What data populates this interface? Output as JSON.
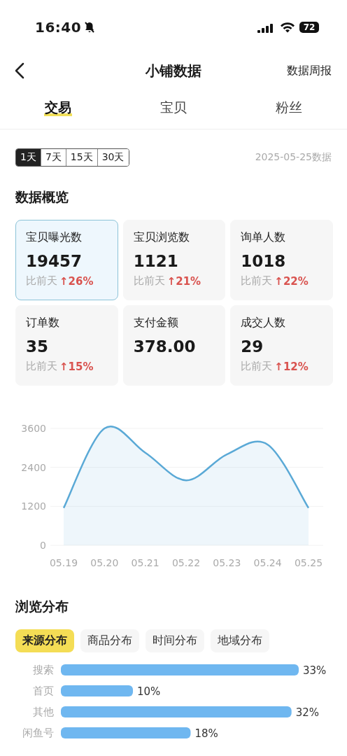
{
  "status_bar": {
    "time": "16:40",
    "battery": "72"
  },
  "nav": {
    "title": "小铺数据",
    "action": "数据周报"
  },
  "tabs": [
    {
      "label": "交易",
      "selected": true
    },
    {
      "label": "宝贝",
      "selected": false
    },
    {
      "label": "粉丝",
      "selected": false
    }
  ],
  "periods": [
    {
      "label": "1天",
      "selected": true
    },
    {
      "label": "7天",
      "selected": false
    },
    {
      "label": "15天",
      "selected": false
    },
    {
      "label": "30天",
      "selected": false
    }
  ],
  "date_note": "2025-05-25数据",
  "overview": {
    "title": "数据概览",
    "stats": [
      {
        "label": "宝贝曝光数",
        "value": "19457",
        "compare": "比前天",
        "change": "↑26%",
        "selected": true
      },
      {
        "label": "宝贝浏览数",
        "value": "1121",
        "compare": "比前天",
        "change": "↑21%",
        "selected": false
      },
      {
        "label": "询单人数",
        "value": "1018",
        "compare": "比前天",
        "change": "↑22%",
        "selected": false
      },
      {
        "label": "订单数",
        "value": "35",
        "compare": "比前天",
        "change": "↑15%",
        "selected": false
      },
      {
        "label": "支付金额",
        "value": "378.00",
        "selected": false
      },
      {
        "label": "成交人数",
        "value": "29",
        "compare": "比前天",
        "change": "↑12%",
        "selected": false
      }
    ]
  },
  "trend_chart": {
    "chart_data": {
      "type": "area",
      "categories": [
        "05.19",
        "05.20",
        "05.21",
        "05.22",
        "05.23",
        "05.24",
        "05.25"
      ],
      "series": [
        {
          "color": "#5aa9d6",
          "values": [
            1150,
            3600,
            2850,
            2000,
            2800,
            3100,
            1150
          ]
        }
      ],
      "ylim": [
        0,
        3600
      ],
      "yticks": [
        0,
        1200,
        2400,
        3600
      ]
    }
  },
  "distribution": {
    "title": "浏览分布",
    "chips": [
      {
        "label": "来源分布",
        "selected": true
      },
      {
        "label": "商品分布",
        "selected": false
      },
      {
        "label": "时间分布",
        "selected": false
      },
      {
        "label": "地域分布",
        "selected": false
      }
    ],
    "chart_data": {
      "type": "bar",
      "orientation": "horizontal",
      "categories": [
        "搜索",
        "首页",
        "其他",
        "闲鱼号"
      ],
      "values": [
        33,
        10,
        32,
        18
      ],
      "value_labels": [
        "33%",
        "10%",
        "32%",
        "18%"
      ]
    }
  }
}
